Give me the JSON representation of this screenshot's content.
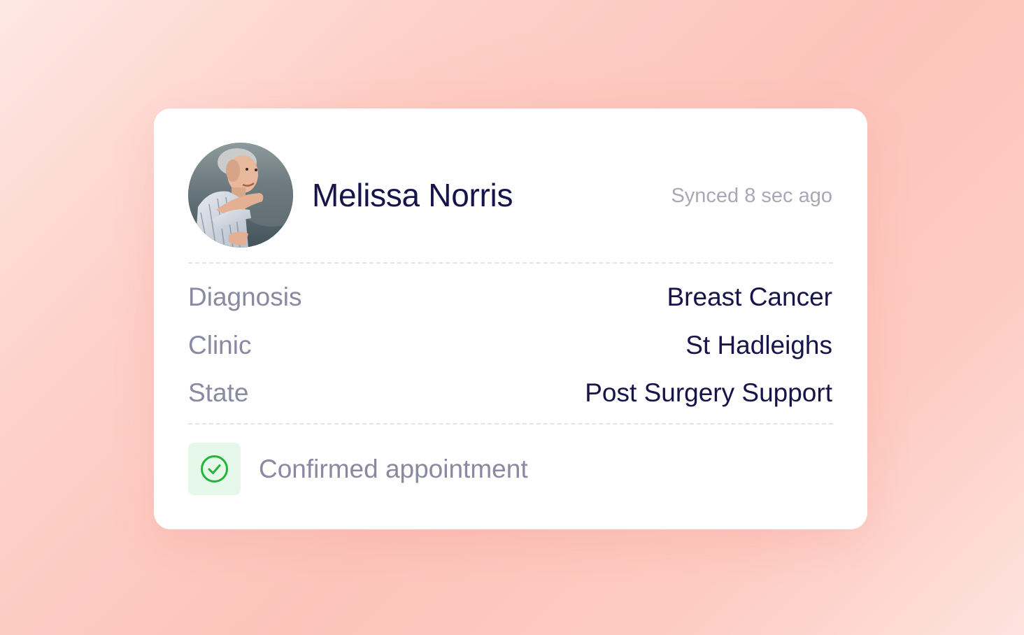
{
  "patient": {
    "name": "Melissa Norris",
    "avatar_icon": "patient-photo",
    "sync_status": "Synced 8 sec ago"
  },
  "details": [
    {
      "label": "Diagnosis",
      "value": "Breast Cancer"
    },
    {
      "label": "Clinic",
      "value": "St Hadleighs"
    },
    {
      "label": "State",
      "value": "Post Surgery Support"
    }
  ],
  "appointment": {
    "icon": "check-circle-icon",
    "text": "Confirmed appointment"
  },
  "colors": {
    "name_text": "#16144a",
    "label_text": "#8a89a2",
    "muted_text": "#a9a8b6",
    "success_green": "#22b53a",
    "success_bg": "#e6f8e9",
    "background": "#fcc4bb"
  }
}
